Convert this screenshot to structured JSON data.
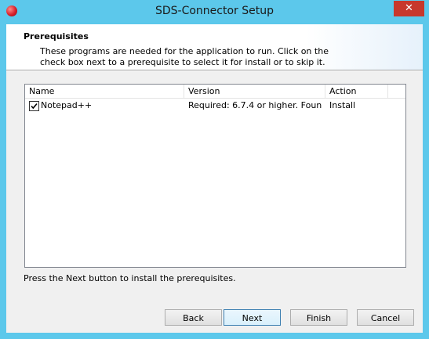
{
  "window": {
    "title": "SDS-Connector Setup",
    "close_label": "✕"
  },
  "header": {
    "title": "Prerequisites",
    "description": "These programs are needed for the application to run. Click on the check box next to a prerequisite to select it for install or to skip it."
  },
  "list": {
    "columns": [
      "Name",
      "Version",
      "Action"
    ],
    "rows": [
      {
        "checked": true,
        "name": "Notepad++",
        "version": "Required: 6.7.4 or higher. Foun...",
        "action": "Install"
      }
    ]
  },
  "footer": {
    "text": "Press the Next button to install the prerequisites."
  },
  "buttons": {
    "back": "Back",
    "next": "Next",
    "finish": "Finish",
    "cancel": "Cancel"
  },
  "colors": {
    "window_frame": "#5cc8eb",
    "close_button": "#c7382c"
  }
}
